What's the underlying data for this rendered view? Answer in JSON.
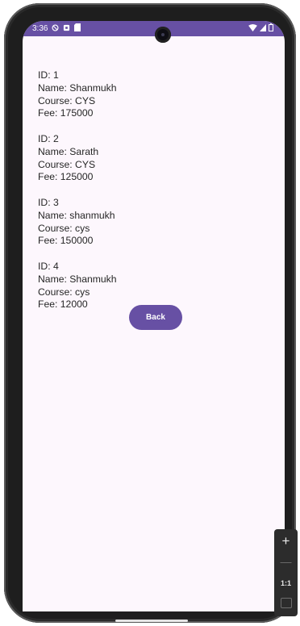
{
  "status_bar": {
    "time": "3:36"
  },
  "records": [
    {
      "id": "ID: 1",
      "name": "Name: Shanmukh",
      "course": "Course: CYS",
      "fee": "Fee: 175000"
    },
    {
      "id": "ID: 2",
      "name": "Name: Sarath",
      "course": "Course: CYS",
      "fee": "Fee: 125000"
    },
    {
      "id": "ID: 3",
      "name": "Name: shanmukh",
      "course": "Course: cys",
      "fee": "Fee: 150000"
    },
    {
      "id": "ID: 4",
      "name": "Name: Shanmukh",
      "course": "Course: cys",
      "fee": "Fee: 12000"
    }
  ],
  "back_button_label": "Back",
  "zoom_controls": {
    "zoom_in": "+",
    "zoom_out": "—",
    "reset": "1:1"
  },
  "colors": {
    "accent": "#6750a4",
    "background": "#fdf7fd"
  }
}
